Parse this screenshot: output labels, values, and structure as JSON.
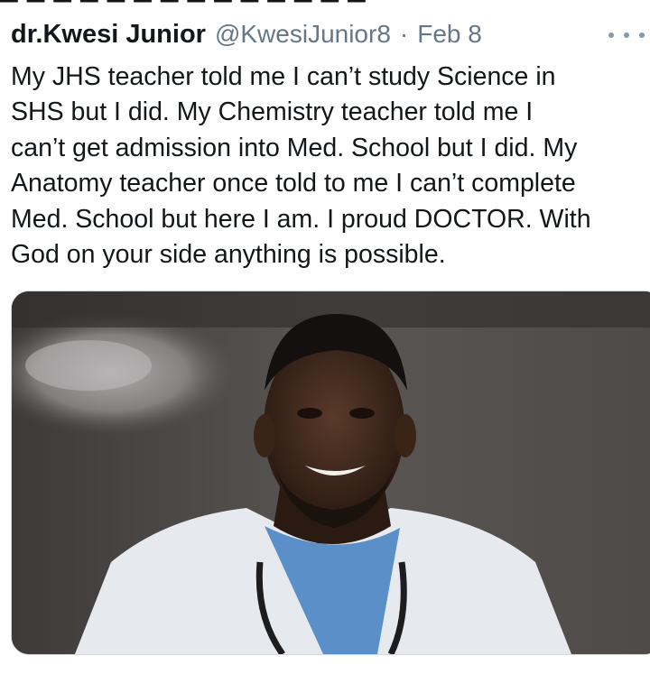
{
  "tweet": {
    "display_name": "dr.Kwesi Junior",
    "handle": "@KwesiJunior8",
    "separator": "·",
    "date": "Feb 8",
    "more_icon": "ellipsis-icon",
    "text_lines": [
      "My JHS teacher told me I can’t study Science in",
      "SHS but I did. My Chemistry teacher told me I",
      "can’t get admission into Med. School but I did. My",
      "Anatomy teacher once told to me I can’t complete",
      "Med. School but here I am. I proud DOCTOR. With",
      "God on your side anything is possible."
    ]
  },
  "colors": {
    "text": "#14171a",
    "muted": "#657786",
    "media_border": "#cfd9de"
  }
}
